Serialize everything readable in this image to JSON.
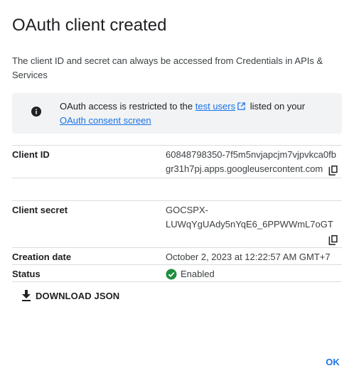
{
  "dialog": {
    "title": "OAuth client created",
    "description": "The client ID and secret can always be accessed from Credentials in APIs & Services"
  },
  "notice": {
    "icon": "info-icon",
    "text_before": "OAuth access is restricted to the",
    "test_users_link": "test users",
    "text_middle": "listed on your",
    "consent_link": "OAuth consent screen"
  },
  "details": {
    "client_id_label": "Client ID",
    "client_id_line1": "60848798350-7f5m5nvjapcjm7vjpvkca0fb",
    "client_id_line2": "gr31h7pj.apps.googleusercontent.com",
    "client_secret_label": "Client secret",
    "client_secret_line1": "GOCSPX-",
    "client_secret_line2": "LUWqYgUAdy5nYqE6_6PPWWmL7oGT",
    "creation_date_label": "Creation date",
    "creation_date_value": "October 2, 2023 at 12:22:57 AM GMT+7",
    "status_label": "Status",
    "status_value": "Enabled",
    "status_color": "#1e8e3e"
  },
  "actions": {
    "download_label": "DOWNLOAD JSON",
    "ok_label": "OK"
  },
  "colors": {
    "accent": "#1a73e8",
    "notice_bg": "#f1f3f4"
  }
}
